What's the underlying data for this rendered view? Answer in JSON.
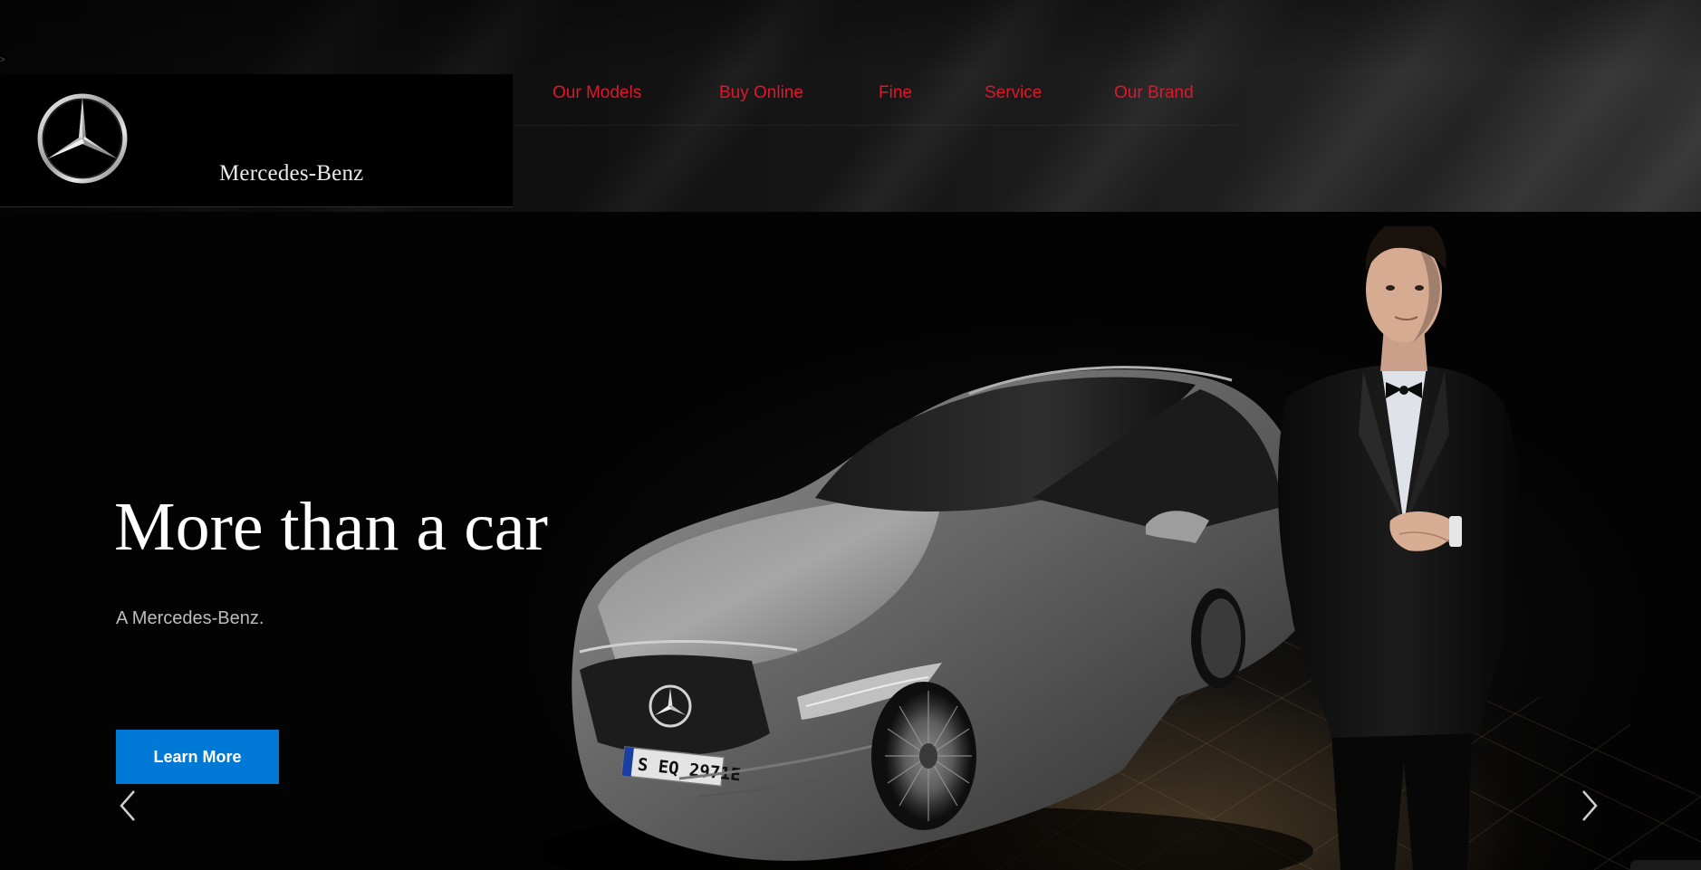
{
  "brand": {
    "name": "Mercedes-Benz",
    "logo_icon": "three-pointed-star-icon"
  },
  "nav": {
    "items": [
      {
        "label": "Our Models"
      },
      {
        "label": "Buy Online"
      },
      {
        "label": "Fine"
      },
      {
        "label": "Service"
      },
      {
        "label": "Our Brand"
      }
    ]
  },
  "hero": {
    "headline": "More than a car",
    "subline": "A Mercedes-Benz.",
    "cta_label": "Learn More",
    "license_plate": "S EQ 2971E",
    "prev_icon": "chevron-left-icon",
    "next_icon": "chevron-right-icon"
  },
  "colors": {
    "nav_text": "#e0162b",
    "cta_bg": "#0078d6",
    "background": "#030303",
    "headline": "#ffffff"
  }
}
